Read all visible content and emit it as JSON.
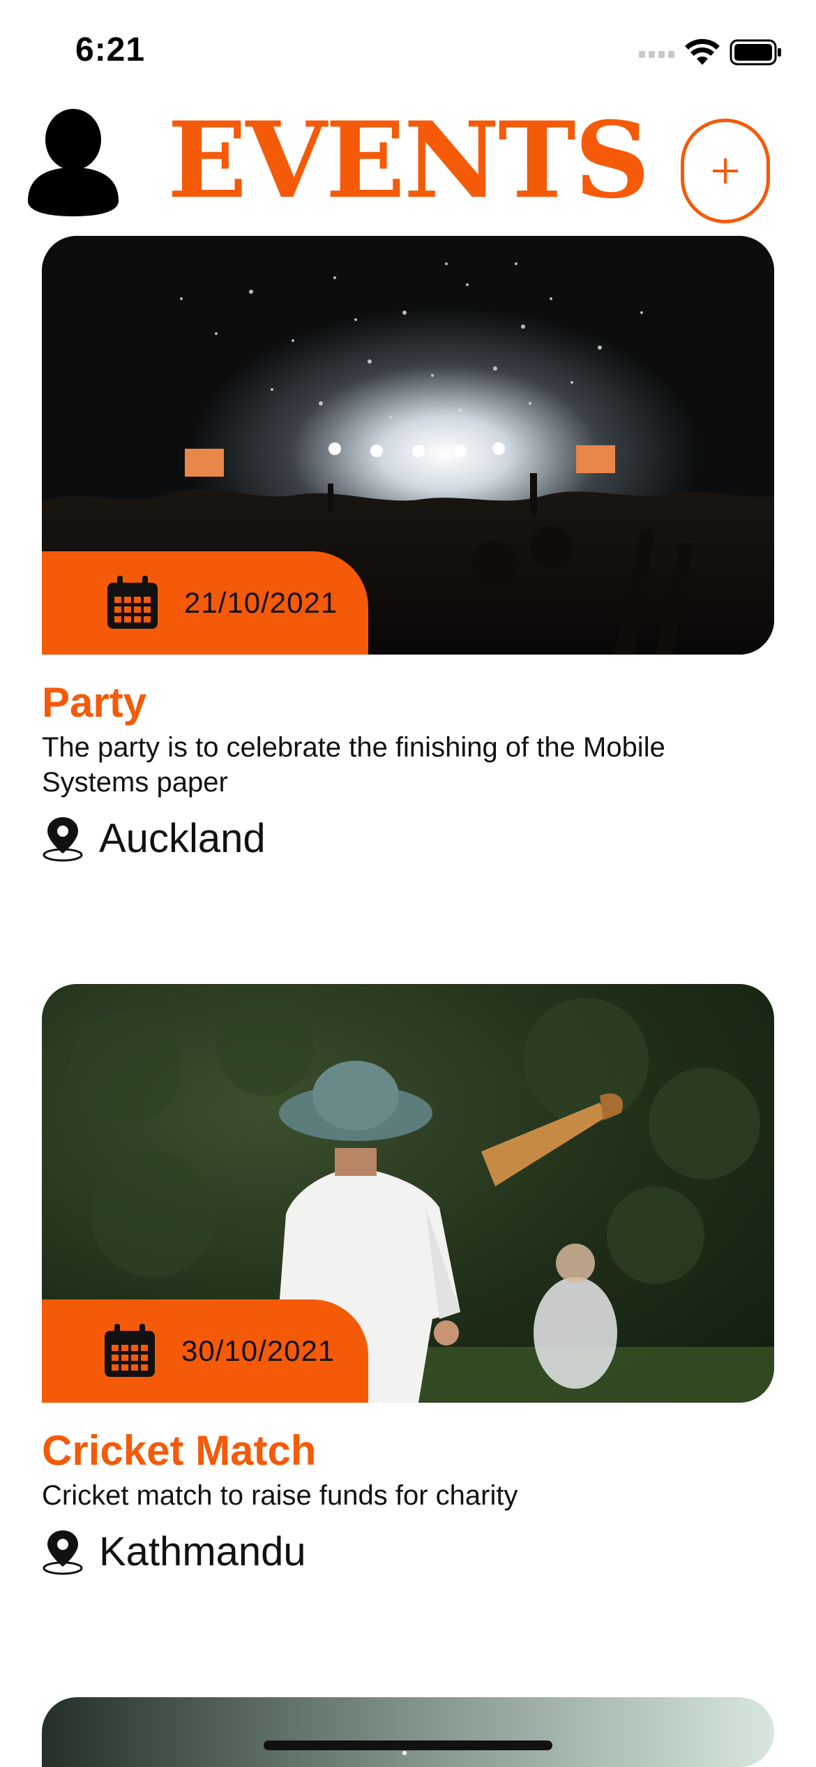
{
  "status_bar": {
    "time": "6:21"
  },
  "header": {
    "title": "EVENTS"
  },
  "events": [
    {
      "date": "21/10/2021",
      "title": "Party",
      "description": "The party is to celebrate the finishing of the Mobile Systems paper",
      "location": "Auckland"
    },
    {
      "date": "30/10/2021",
      "title": "Cricket Match",
      "description": "Cricket match to raise funds for charity",
      "location": "Kathmandu"
    }
  ],
  "colors": {
    "accent": "#f55a09"
  }
}
